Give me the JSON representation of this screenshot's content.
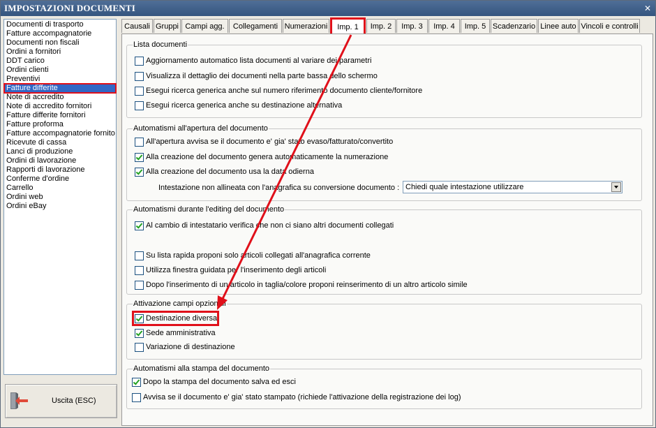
{
  "window": {
    "title": "IMPOSTAZIONI DOCUMENTI",
    "close_glyph": "✕"
  },
  "doc_list": {
    "items": [
      "Documenti di trasporto",
      "Fatture accompagnatorie",
      "Documenti non fiscali",
      "Ordini a fornitori",
      "DDT carico",
      "Ordini clienti",
      "Preventivi",
      "Fatture differite",
      "Note di accredito",
      "Note di accredito fornitori",
      "Fatture differite fornitori",
      "Fatture proforma",
      "Fatture accompagnatorie fornito",
      "Ricevute di cassa",
      "Lanci di produzione",
      "Ordini di lavorazione",
      "Rapporti di lavorazione",
      "Conferme d'ordine",
      "Carrello",
      "Ordini web",
      "Ordini eBay"
    ],
    "selected_index": 7
  },
  "exit_button": {
    "label": "Uscita (ESC)",
    "icon": "exit-door-icon"
  },
  "tabs": [
    "Causali",
    "Gruppi",
    "Campi agg.",
    "Collegamenti",
    "Numerazioni",
    "Imp. 1",
    "Imp. 2",
    "Imp. 3",
    "Imp. 4",
    "Imp. 5",
    "Scadenzario",
    "Linee auto",
    "Vincoli e controlli"
  ],
  "active_tab_index": 5,
  "groups": {
    "lista": {
      "title": "Lista documenti",
      "options": [
        {
          "label": "Aggiornamento automatico lista documenti al variare dei parametri",
          "checked": false
        },
        {
          "label": "Visualizza il dettaglio dei documenti nella parte bassa dello schermo",
          "checked": false
        },
        {
          "label": "Esegui ricerca generica anche sul numero riferimento documento cliente/fornitore",
          "checked": false
        },
        {
          "label": "Esegui ricerca generica anche su destinazione alternativa",
          "checked": false
        }
      ]
    },
    "apertura": {
      "title": "Automatismi all'apertura del documento",
      "options": [
        {
          "label": "All'apertura avvisa se il documento e' gia' stato evaso/fatturato/convertito",
          "checked": false
        },
        {
          "label": "Alla creazione del documento genera automaticamente la numerazione",
          "checked": true
        },
        {
          "label": "Alla creazione del documento usa la data odierna",
          "checked": true
        }
      ],
      "combo_label": "Intestazione non allineata con l'anagrafica su conversione documento :",
      "combo_value": "Chiedi quale intestazione utilizzare"
    },
    "editing": {
      "title": "Automatismi durante l'editing del documento",
      "options": [
        {
          "label": "Al cambio di intestatario verifica che non ci siano altri documenti collegati",
          "checked": true
        },
        {
          "label": "Su lista rapida proponi solo articoli collegati all'anagrafica corrente",
          "checked": false
        },
        {
          "label": "Utilizza finestra guidata per l'inserimento degli articoli",
          "checked": false
        },
        {
          "label": "Dopo l'inserimento di un articolo in taglia/colore proponi reinserimento di un altro articolo simile",
          "checked": false
        }
      ]
    },
    "opzionali": {
      "title": "Attivazione campi opzionali",
      "options": [
        {
          "label": "Destinazione diversa",
          "checked": true
        },
        {
          "label": "Sede amministrativa",
          "checked": true
        },
        {
          "label": "Variazione di destinazione",
          "checked": false
        }
      ]
    },
    "stampa": {
      "title": "Automatismi alla stampa del documento",
      "options": [
        {
          "label": "Dopo la stampa del documento salva ed esci",
          "checked": true
        },
        {
          "label": "Avvisa se il documento e' gia' stato stampato (richiede l'attivazione della registrazione dei log)",
          "checked": false
        }
      ]
    }
  },
  "colors": {
    "highlight": "#e0101a",
    "selection": "#3167c5",
    "title_bar": "#35557f",
    "check": "#21a121"
  }
}
